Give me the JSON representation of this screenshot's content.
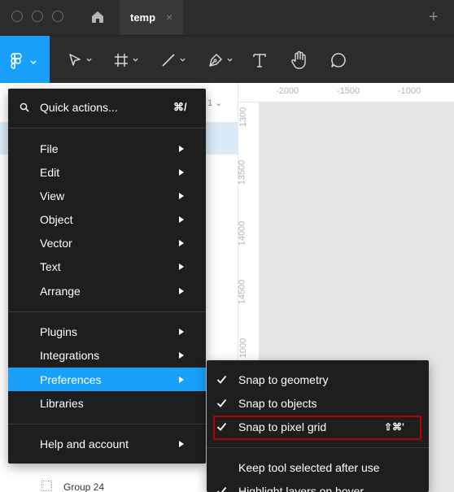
{
  "titlebar": {
    "tab_label": "temp",
    "tab_close": "×",
    "new_tab": "+"
  },
  "toolbar": {
    "tools": [
      "figma-menu-icon",
      "move-icon",
      "frame-icon",
      "line-icon",
      "pen-icon",
      "text-icon",
      "hand-icon",
      "comment-icon"
    ],
    "accent_color": "#18a0fb"
  },
  "ruler": {
    "top_labels": [
      "-2000",
      "-1500",
      "-1000"
    ],
    "left_labels": [
      "1300",
      "13500",
      "14000",
      "14500",
      "1000"
    ]
  },
  "panel": {
    "page_chevron": "1 ⌄",
    "layer_label": "Group 24"
  },
  "main_menu": {
    "quick_actions": {
      "label": "Quick actions...",
      "shortcut": "⌘/"
    },
    "items": [
      {
        "label": "File",
        "has_submenu": true
      },
      {
        "label": "Edit",
        "has_submenu": true
      },
      {
        "label": "View",
        "has_submenu": true
      },
      {
        "label": "Object",
        "has_submenu": true
      },
      {
        "label": "Vector",
        "has_submenu": true
      },
      {
        "label": "Text",
        "has_submenu": true
      },
      {
        "label": "Arrange",
        "has_submenu": true
      },
      {
        "label": "Plugins",
        "has_submenu": true
      },
      {
        "label": "Integrations",
        "has_submenu": true
      },
      {
        "label": "Preferences",
        "has_submenu": true,
        "active": true
      },
      {
        "label": "Libraries",
        "has_submenu": false
      },
      {
        "label": "Help and account",
        "has_submenu": true
      }
    ]
  },
  "preferences_submenu": {
    "items": [
      {
        "label": "Snap to geometry",
        "checked": true,
        "shortcut": ""
      },
      {
        "label": "Snap to objects",
        "checked": true,
        "shortcut": ""
      },
      {
        "label": "Snap to pixel grid",
        "checked": true,
        "shortcut": "⇧⌘'"
      },
      {
        "label": "Keep tool selected after use",
        "checked": false,
        "shortcut": ""
      },
      {
        "label": "Highlight layers on hover",
        "checked": true,
        "shortcut": ""
      }
    ]
  }
}
